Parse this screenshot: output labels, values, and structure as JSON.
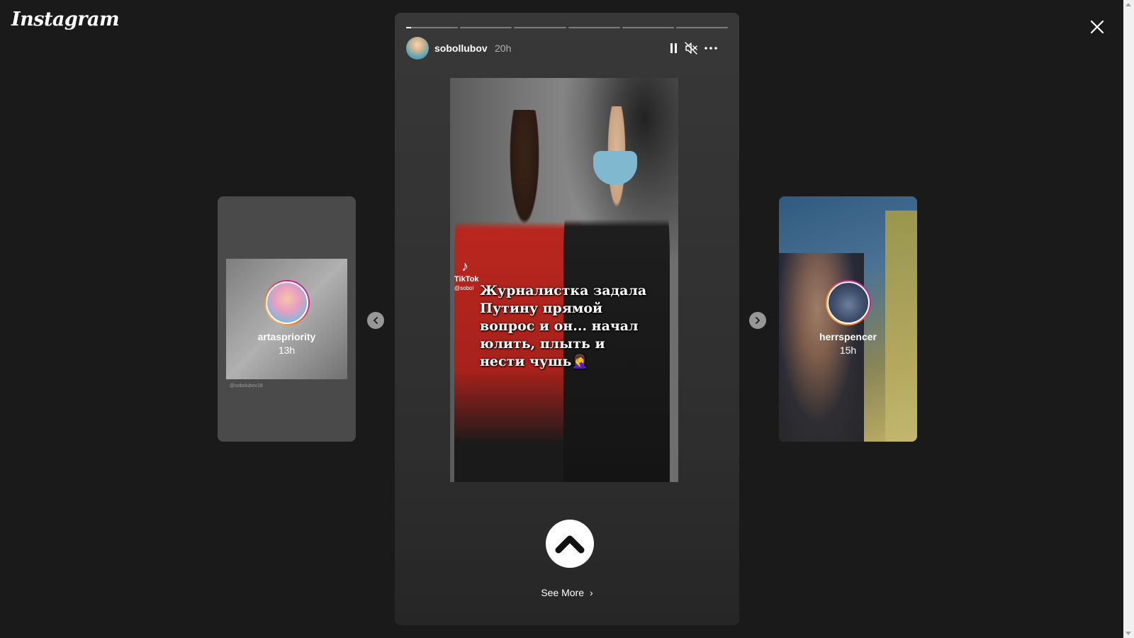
{
  "app": {
    "logo_text": "Instagram"
  },
  "left_story": {
    "username": "artaspriority",
    "time": "13h",
    "watermark": "@sobolubov18"
  },
  "right_story": {
    "username": "herrspencer",
    "time": "15h"
  },
  "main_story": {
    "username": "sobollubov",
    "time": "20h",
    "segments": 6,
    "progress": [
      0.1,
      0,
      0,
      0,
      0,
      0
    ],
    "tiktok_label": "TikTok",
    "tiktok_handle": "@sobol",
    "caption": "Журналистка задала Путину прямой вопрос и он... начал юлить, плыть и нести чушь🤦‍♀️",
    "see_more": "See More"
  },
  "icons": {
    "close": "close-icon",
    "pause": "pause-icon",
    "mute": "muted-speaker-icon",
    "more": "more-options-icon",
    "prev": "chevron-left-icon",
    "next": "chevron-right-icon",
    "swipe": "chevron-up-icon"
  },
  "colors": {
    "background": "#1a1a1a",
    "story_ring_start": "#feda75",
    "story_ring_end": "#962fbf"
  }
}
